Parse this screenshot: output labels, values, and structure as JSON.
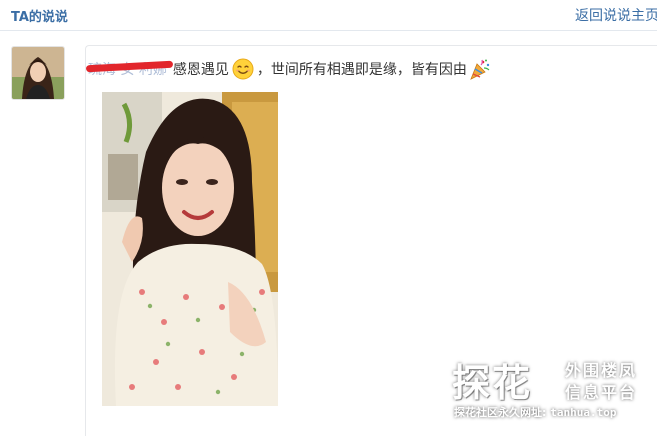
{
  "header": {
    "title": "TA的说说",
    "back_link": "返回说说主页"
  },
  "post": {
    "author": "琉海 女 利娜",
    "text": "感恩遇见",
    "text_after_emoji": "，世间所有相遇即是缘，皆有因由",
    "emoji_1": "smiling-face-icon",
    "emoji_2": "party-popper-icon",
    "redaction_color": "#e2262c"
  },
  "watermark": {
    "brand": "探花",
    "line1": "外围楼凤",
    "line2": "信息平台",
    "bottom_label": "探花社区永久网址:",
    "bottom_url": "tanhua.top"
  },
  "colors": {
    "link_blue": "#3b6ea5",
    "border": "#e3e8ee"
  }
}
